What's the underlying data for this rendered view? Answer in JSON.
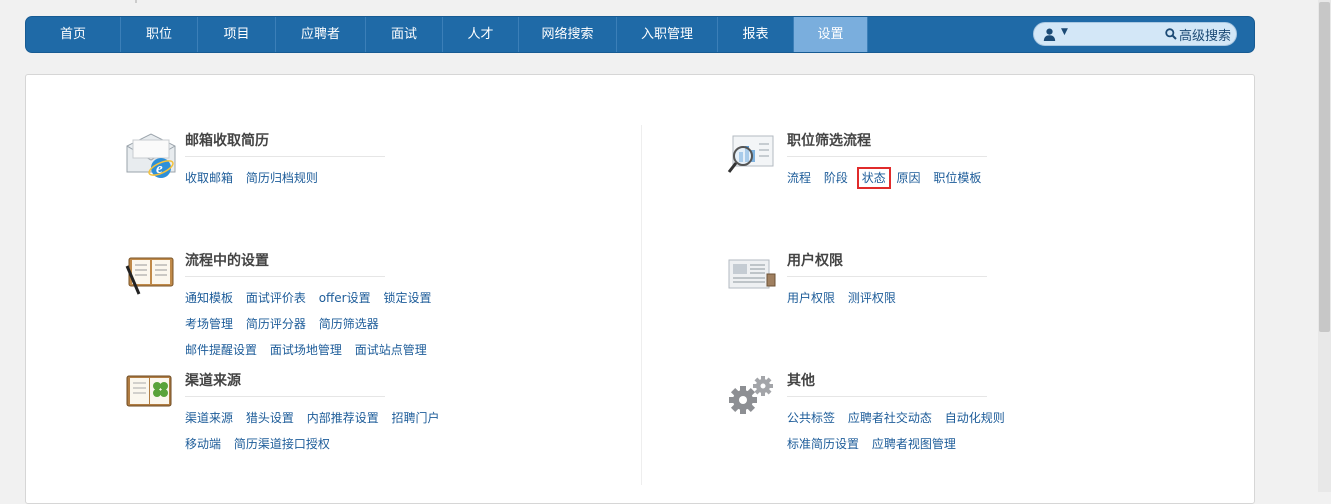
{
  "nav": {
    "items": [
      {
        "label": "首页"
      },
      {
        "label": "职位"
      },
      {
        "label": "项目"
      },
      {
        "label": "应聘者"
      },
      {
        "label": "面试"
      },
      {
        "label": "人才"
      },
      {
        "label": "网络搜索"
      },
      {
        "label": "入职管理"
      },
      {
        "label": "报表"
      },
      {
        "label": "设置",
        "active": true
      }
    ],
    "advanced_search_label": "高级搜索",
    "search_value": ""
  },
  "sections": {
    "email": {
      "title": "邮箱收取简历",
      "rows": [
        [
          "收取邮箱",
          "简历归档规则"
        ]
      ]
    },
    "workflow": {
      "title": "职位筛选流程",
      "rows": [
        [
          "流程",
          "阶段",
          "状态",
          "原因",
          "职位模板"
        ]
      ]
    },
    "process": {
      "title": "流程中的设置",
      "rows": [
        [
          "通知模板",
          "面试评价表",
          "offer设置",
          "锁定设置"
        ],
        [
          "考场管理",
          "简历评分器",
          "简历筛选器"
        ],
        [
          "邮件提醒设置",
          "面试场地管理",
          "面试站点管理"
        ]
      ]
    },
    "permission": {
      "title": "用户权限",
      "rows": [
        [
          "用户权限",
          "测评权限"
        ]
      ]
    },
    "channel": {
      "title": "渠道来源",
      "rows": [
        [
          "渠道来源",
          "猎头设置",
          "内部推荐设置",
          "招聘门户"
        ],
        [
          "移动端",
          "简历渠道接口授权"
        ]
      ]
    },
    "other": {
      "title": "其他",
      "rows": [
        [
          "公共标签",
          "应聘者社交动态",
          "自动化规则"
        ],
        [
          "标准简历设置",
          "应聘者视图管理"
        ]
      ]
    }
  },
  "colors": {
    "nav_bg": "#1f6aa7",
    "nav_active": "#7aaedd",
    "link": "#1d5c99",
    "highlight": "#e02b2b"
  }
}
